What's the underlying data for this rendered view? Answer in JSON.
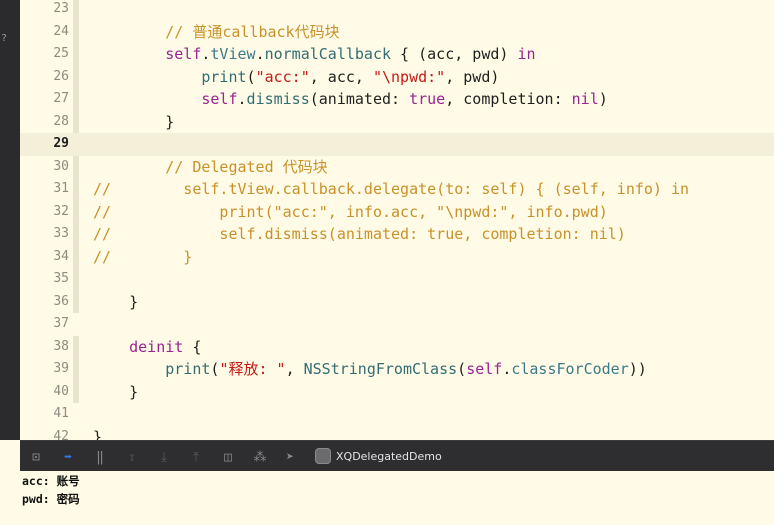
{
  "left_strip": {
    "char": "?"
  },
  "editor": {
    "lines": [
      {
        "num": "23",
        "top": 0,
        "current": false,
        "fold": true,
        "code": []
      },
      {
        "num": "24",
        "current": false,
        "fold": true,
        "code": [
          {
            "t": "        "
          },
          {
            "t": "// 普通callback代码块",
            "c": "c"
          }
        ]
      },
      {
        "num": "25",
        "current": false,
        "fold": true,
        "code": [
          {
            "t": "        "
          },
          {
            "t": "self",
            "c": "k"
          },
          {
            "t": "."
          },
          {
            "t": "tView",
            "c": "pr"
          },
          {
            "t": "."
          },
          {
            "t": "normalCallback",
            "c": "fn"
          },
          {
            "t": " { (acc, pwd) "
          },
          {
            "t": "in",
            "c": "k"
          }
        ]
      },
      {
        "num": "26",
        "current": false,
        "fold": true,
        "code": [
          {
            "t": "            "
          },
          {
            "t": "print",
            "c": "fn"
          },
          {
            "t": "("
          },
          {
            "t": "\"acc:\"",
            "c": "s"
          },
          {
            "t": ", acc, "
          },
          {
            "t": "\"\\npwd:\"",
            "c": "s"
          },
          {
            "t": ", pwd)"
          }
        ]
      },
      {
        "num": "27",
        "current": false,
        "fold": true,
        "code": [
          {
            "t": "            "
          },
          {
            "t": "self",
            "c": "k"
          },
          {
            "t": "."
          },
          {
            "t": "dismiss",
            "c": "fn"
          },
          {
            "t": "(animated: "
          },
          {
            "t": "true",
            "c": "k"
          },
          {
            "t": ", completion: "
          },
          {
            "t": "nil",
            "c": "k"
          },
          {
            "t": ")"
          }
        ]
      },
      {
        "num": "28",
        "current": false,
        "fold": true,
        "code": [
          {
            "t": "        }"
          }
        ]
      },
      {
        "num": "29",
        "current": true,
        "fold": false,
        "code": []
      },
      {
        "num": "30",
        "current": false,
        "fold": true,
        "code": [
          {
            "t": "        "
          },
          {
            "t": "// Delegated 代码块",
            "c": "c"
          }
        ]
      },
      {
        "num": "31",
        "current": false,
        "fold": true,
        "code": [
          {
            "t": "//        self.tView.callback.delegate(to: self) { (self, info) in",
            "c": "c"
          }
        ]
      },
      {
        "num": "32",
        "current": false,
        "fold": true,
        "code": [
          {
            "t": "//            print(\"acc:\", info.acc, \"\\npwd:\", info.pwd)",
            "c": "c"
          }
        ]
      },
      {
        "num": "33",
        "current": false,
        "fold": true,
        "code": [
          {
            "t": "//            self.dismiss(animated: true, completion: nil)",
            "c": "c"
          }
        ]
      },
      {
        "num": "34",
        "current": false,
        "fold": true,
        "code": [
          {
            "t": "//        }",
            "c": "c"
          }
        ]
      },
      {
        "num": "35",
        "current": false,
        "fold": true,
        "code": []
      },
      {
        "num": "36",
        "current": false,
        "fold": true,
        "code": [
          {
            "t": "    }"
          }
        ]
      },
      {
        "num": "37",
        "current": false,
        "fold": false,
        "code": []
      },
      {
        "num": "38",
        "current": false,
        "fold": true,
        "code": [
          {
            "t": "    "
          },
          {
            "t": "deinit",
            "c": "k"
          },
          {
            "t": " {"
          }
        ]
      },
      {
        "num": "39",
        "current": false,
        "fold": true,
        "code": [
          {
            "t": "        "
          },
          {
            "t": "print",
            "c": "fn"
          },
          {
            "t": "("
          },
          {
            "t": "\"释放: \"",
            "c": "s"
          },
          {
            "t": ", "
          },
          {
            "t": "NSStringFromClass",
            "c": "fn"
          },
          {
            "t": "("
          },
          {
            "t": "self",
            "c": "k"
          },
          {
            "t": "."
          },
          {
            "t": "classForCoder",
            "c": "pr"
          },
          {
            "t": "))"
          }
        ]
      },
      {
        "num": "40",
        "current": false,
        "fold": true,
        "code": [
          {
            "t": "    }"
          }
        ]
      },
      {
        "num": "41",
        "current": false,
        "fold": false,
        "code": []
      },
      {
        "num": "42",
        "current": false,
        "fold": false,
        "code": [
          {
            "t": "}"
          }
        ]
      }
    ]
  },
  "toolbar": {
    "buttons": [
      {
        "name": "hide-debug-area-icon",
        "glyph": "⊡",
        "style": "",
        "interactable": true
      },
      {
        "name": "breakpoints-toggle-icon",
        "glyph": "➡",
        "style": "blue",
        "interactable": true
      },
      {
        "name": "pause-icon",
        "glyph": "‖",
        "style": "",
        "interactable": true
      },
      {
        "name": "step-over-icon",
        "glyph": "⇧",
        "style": "dim",
        "interactable": true
      },
      {
        "name": "step-into-icon",
        "glyph": "⤓",
        "style": "dim",
        "interactable": true
      },
      {
        "name": "step-out-icon",
        "glyph": "⤒",
        "style": "dim",
        "interactable": true
      },
      {
        "name": "view-hierarchy-icon",
        "glyph": "◫",
        "style": "",
        "interactable": true
      },
      {
        "name": "memory-graph-icon",
        "glyph": "⁂",
        "style": "",
        "interactable": true
      },
      {
        "name": "simulate-location-icon",
        "glyph": "➤",
        "style": "",
        "interactable": true
      }
    ],
    "app_name": "XQDelegatedDemo"
  },
  "console": {
    "lines": [
      "acc: 账号",
      "pwd: 密码"
    ]
  }
}
